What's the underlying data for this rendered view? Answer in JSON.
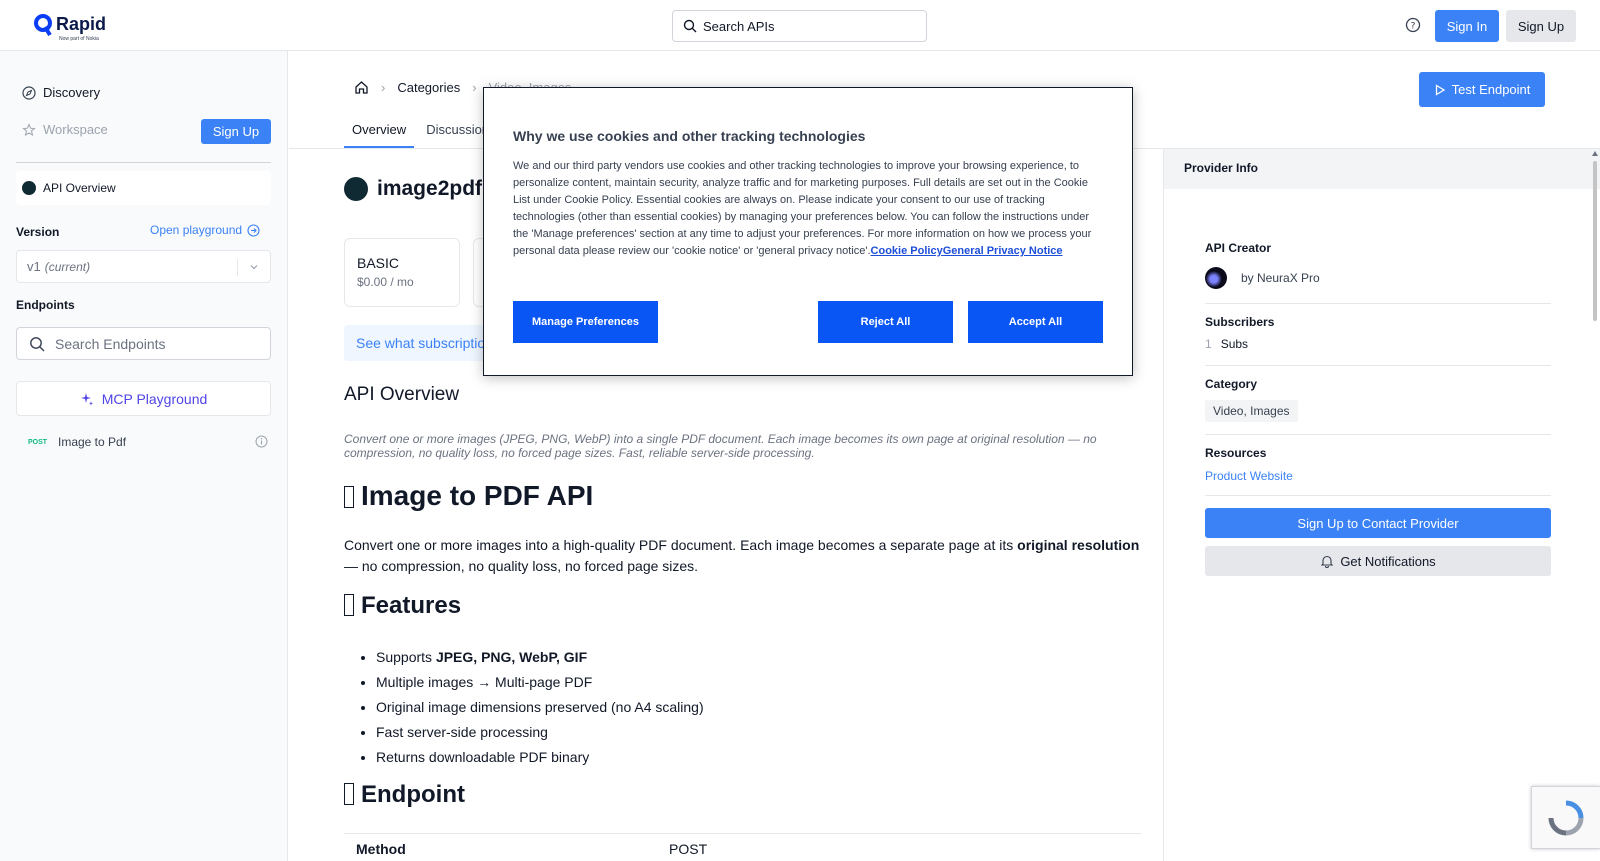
{
  "brand": {
    "name": "Rapid",
    "tagline": "Now part of Nokia",
    "accent": "#3b82f6"
  },
  "header": {
    "search_placeholder": "Search APIs",
    "sign_in": "Sign In",
    "sign_up": "Sign Up"
  },
  "sidebar": {
    "discovery": "Discovery",
    "workspace": "Workspace",
    "sign_up": "Sign Up",
    "api_overview": "API Overview",
    "version_label": "Version",
    "open_playground": "Open playground",
    "version_value": "v1",
    "version_tag": "(current)",
    "endpoints_label": "Endpoints",
    "search_endpoints": "Search Endpoints",
    "mcp_playground": "MCP Playground",
    "endpoints": [
      {
        "method": "POST",
        "name": "Image to Pdf"
      }
    ]
  },
  "breadcrumb": {
    "categories": "Categories",
    "category": "Video, Images",
    "api": "image2pdf"
  },
  "test_endpoint": "Test Endpoint",
  "tabs": [
    "Overview",
    "Discussions"
  ],
  "api": {
    "title": "image2pdf",
    "plans": [
      {
        "name": "BASIC",
        "price": "$0.00 / mo"
      }
    ],
    "subs_link": "See what subscriptions",
    "overview_heading": "API Overview",
    "short_description": "Convert one or more images (JPEG, PNG, WebP) into a single PDF document. Each image becomes its own page at original resolution — no compression, no quality loss, no forced page sizes. Fast, reliable server-side processing.",
    "h1": "Image to PDF API",
    "intro_pre": "Convert one or more images into a high-quality PDF document. Each image becomes a separate page at its ",
    "intro_bold": "original resolution",
    "intro_post": " — no compression, no quality loss, no forced page sizes.",
    "features_heading": "Features",
    "feature_supports_pre": "Supports ",
    "feature_supports_bold": "JPEG, PNG, WebP, GIF",
    "features": [
      "Multiple images → Multi-page PDF",
      "Original image dimensions preserved (no A4 scaling)",
      "Fast server-side processing",
      "Returns downloadable PDF binary"
    ],
    "endpoint_heading": "Endpoint",
    "table": {
      "method_label": "Method",
      "method_value": "POST"
    }
  },
  "provider": {
    "heading": "Provider Info",
    "creator_label": "API Creator",
    "creator": "by NeuraX Pro",
    "subscribers_label": "Subscribers",
    "subscribers_count": "1",
    "subscribers_unit": "Subs",
    "category_label": "Category",
    "category": "Video, Images",
    "resources_label": "Resources",
    "product_website": "Product Website",
    "contact": "Sign Up to Contact Provider",
    "notifications": "Get Notifications"
  },
  "cookie": {
    "title": "Why we use cookies and other tracking technologies",
    "body": "We and our third party vendors use cookies and other tracking technologies to improve your browsing experience, to personalize content, maintain security, analyze traffic and for marketing purposes. Full details are set out in the Cookie List under Cookie Policy. Essential cookies are always on. Please indicate your consent to our use of tracking technologies (other than essential cookies) by managing your preferences below. You can follow the instructions under the 'Manage preferences' section at any time to adjust your preferences. For more information on how we process your personal data please review our 'cookie notice' or 'general privacy notice'.",
    "cookie_policy": "Cookie Policy",
    "privacy_notice": "General Privacy Notice",
    "manage": "Manage Preferences",
    "reject": "Reject All",
    "accept": "Accept All"
  }
}
